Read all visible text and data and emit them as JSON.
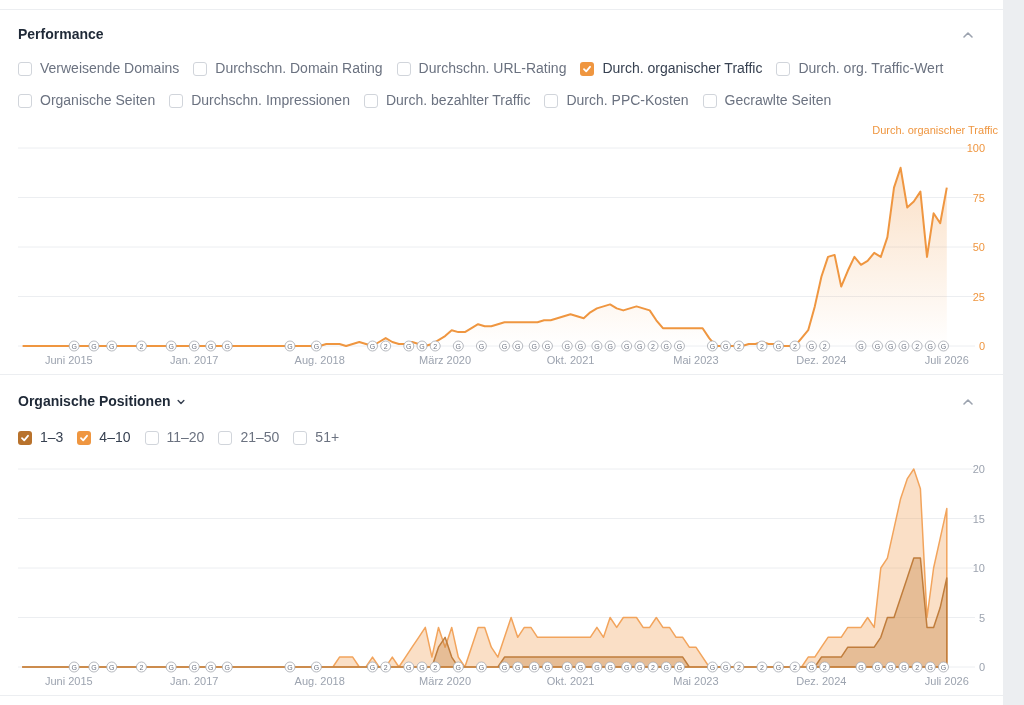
{
  "performance": {
    "title": "Performance",
    "expanded": true,
    "metrics": [
      {
        "label": "Verweisende Domains",
        "checked": false
      },
      {
        "label": "Durchschn. Domain Rating",
        "checked": false
      },
      {
        "label": "Durchschn. URL-Rating",
        "checked": false
      },
      {
        "label": "Durch. organischer Traffic",
        "checked": true
      },
      {
        "label": "Durch. org. Traffic-Wert",
        "checked": false
      },
      {
        "label": "Organische Seiten",
        "checked": false
      },
      {
        "label": "Durchschn. Impressionen",
        "checked": false
      },
      {
        "label": "Durch. bezahlter Traffic",
        "checked": false
      },
      {
        "label": "Durch. PPC-Kosten",
        "checked": false
      },
      {
        "label": "Gecrawlte Seiten",
        "checked": false
      }
    ],
    "chart_data": {
      "type": "line",
      "categories": [
        null,
        null,
        null,
        null,
        null,
        null,
        null,
        "Juni 2015",
        null,
        null,
        null,
        null,
        null,
        null,
        null,
        null,
        null,
        null,
        null,
        null,
        null,
        null,
        null,
        null,
        null,
        null,
        "Jan. 2017",
        null,
        null,
        null,
        null,
        null,
        null,
        null,
        null,
        null,
        null,
        null,
        null,
        null,
        null,
        null,
        null,
        null,
        null,
        "Aug. 2018",
        null,
        null,
        null,
        null,
        null,
        null,
        null,
        null,
        null,
        null,
        null,
        null,
        null,
        null,
        null,
        null,
        null,
        null,
        "März 2020",
        null,
        null,
        null,
        null,
        null,
        null,
        null,
        null,
        null,
        null,
        null,
        null,
        null,
        null,
        null,
        null,
        null,
        null,
        "Okt. 2021",
        null,
        null,
        null,
        null,
        null,
        null,
        null,
        null,
        null,
        null,
        null,
        null,
        null,
        null,
        null,
        null,
        null,
        null,
        "Mai 2023",
        null,
        null,
        null,
        null,
        null,
        null,
        null,
        null,
        null,
        null,
        null,
        null,
        null,
        null,
        null,
        null,
        null,
        null,
        "Dez. 2024",
        null,
        null,
        null,
        null,
        null,
        null,
        null,
        null,
        null,
        null,
        null,
        null,
        null,
        null,
        null,
        null,
        null,
        null,
        "Juli 2026",
        null
      ],
      "series": [
        {
          "name": "Durch. organischer Traffic",
          "color": "#ef9640",
          "values": [
            0,
            0,
            0,
            0,
            0,
            0,
            0,
            0,
            0,
            0,
            0,
            0,
            0,
            0,
            0,
            0,
            0,
            0,
            0,
            0,
            0,
            0,
            0,
            0,
            0,
            0,
            0,
            0,
            0,
            0,
            0,
            0,
            0,
            0,
            0,
            0,
            0,
            0,
            0,
            0,
            0,
            0,
            0,
            0,
            0,
            0,
            1,
            1,
            1,
            0,
            1,
            2,
            1,
            0,
            2,
            4,
            2,
            1,
            1,
            2,
            1,
            0,
            1,
            3,
            5,
            8,
            7,
            7,
            9,
            11,
            10,
            10,
            11,
            12,
            12,
            12,
            12,
            12,
            12,
            13,
            13,
            14,
            15,
            16,
            15,
            14,
            17,
            19,
            20,
            21,
            19,
            18,
            19,
            20,
            19,
            18,
            13,
            9,
            9,
            9,
            9,
            9,
            9,
            9,
            4,
            0,
            0,
            0,
            0,
            0,
            1,
            1,
            2,
            1,
            1,
            0,
            0,
            0,
            4,
            8,
            20,
            35,
            45,
            46,
            30,
            38,
            45,
            41,
            43,
            47,
            45,
            55,
            80,
            90,
            70,
            73,
            78,
            45,
            67,
            62,
            80,
            null
          ]
        }
      ],
      "ylim": [
        0,
        100
      ],
      "grid": true,
      "yticks": [
        0,
        25,
        50,
        75,
        100
      ]
    },
    "update_markers": [
      {
        "text": "G"
      },
      {
        "text": "G"
      },
      {
        "text": "G"
      },
      {
        "text": "2"
      },
      {
        "text": "G"
      },
      {
        "text": "G"
      },
      {
        "text": "G"
      },
      {
        "text": "G"
      },
      {
        "text": "G"
      },
      {
        "text": "G"
      },
      {
        "text": "G"
      },
      {
        "text": "2"
      },
      {
        "text": "G"
      },
      {
        "text": "G"
      },
      {
        "text": "2"
      },
      {
        "text": "G"
      },
      {
        "text": "G"
      },
      {
        "text": "G"
      },
      {
        "text": "G"
      },
      {
        "text": "G"
      },
      {
        "text": "G"
      },
      {
        "text": "G"
      },
      {
        "text": "G"
      },
      {
        "text": "G"
      },
      {
        "text": "G"
      },
      {
        "text": "G"
      },
      {
        "text": "G"
      },
      {
        "text": "2"
      },
      {
        "text": "G"
      },
      {
        "text": "G"
      },
      {
        "text": "G"
      },
      {
        "text": "G"
      },
      {
        "text": "2"
      },
      {
        "text": "2"
      },
      {
        "text": "G"
      },
      {
        "text": "2"
      },
      {
        "text": "G"
      },
      {
        "text": "2"
      },
      {
        "text": "G"
      },
      {
        "text": "G"
      },
      {
        "text": "G"
      },
      {
        "text": "G"
      },
      {
        "text": "2"
      },
      {
        "text": "G"
      },
      {
        "text": "G"
      }
    ]
  },
  "positions": {
    "title": "Organische Positionen",
    "dropdown": true,
    "expanded": true,
    "filters": [
      {
        "label": "1–3",
        "checked": true,
        "color": "#b8722c"
      },
      {
        "label": "4–10",
        "checked": true,
        "color": "#ef9640"
      },
      {
        "label": "11–20",
        "checked": false
      },
      {
        "label": "21–50",
        "checked": false
      },
      {
        "label": "51+",
        "checked": false
      }
    ],
    "chart_data": {
      "type": "area",
      "categories": [
        null,
        null,
        null,
        null,
        null,
        null,
        null,
        "Juni 2015",
        null,
        null,
        null,
        null,
        null,
        null,
        null,
        null,
        null,
        null,
        null,
        null,
        null,
        null,
        null,
        null,
        null,
        null,
        "Jan. 2017",
        null,
        null,
        null,
        null,
        null,
        null,
        null,
        null,
        null,
        null,
        null,
        null,
        null,
        null,
        null,
        null,
        null,
        null,
        "Aug. 2018",
        null,
        null,
        null,
        null,
        null,
        null,
        null,
        null,
        null,
        null,
        null,
        null,
        null,
        null,
        null,
        null,
        null,
        null,
        "März 2020",
        null,
        null,
        null,
        null,
        null,
        null,
        null,
        null,
        null,
        null,
        null,
        null,
        null,
        null,
        null,
        null,
        null,
        null,
        "Okt. 2021",
        null,
        null,
        null,
        null,
        null,
        null,
        null,
        null,
        null,
        null,
        null,
        null,
        null,
        null,
        null,
        null,
        null,
        null,
        "Mai 2023",
        null,
        null,
        null,
        null,
        null,
        null,
        null,
        null,
        null,
        null,
        null,
        null,
        null,
        null,
        null,
        null,
        null,
        null,
        "Dez. 2024",
        null,
        null,
        null,
        null,
        null,
        null,
        null,
        null,
        null,
        null,
        null,
        null,
        null,
        null,
        null,
        null,
        null,
        null,
        "Juli 2026",
        null
      ],
      "series": [
        {
          "color": "#f2a45c",
          "values": [
            0,
            0,
            0,
            0,
            0,
            0,
            0,
            0,
            0,
            0,
            0,
            0,
            0,
            0,
            0,
            0,
            0,
            0,
            0,
            0,
            0,
            0,
            0,
            0,
            0,
            0,
            0,
            0,
            0,
            0,
            0,
            0,
            0,
            0,
            0,
            0,
            0,
            0,
            0,
            0,
            0,
            0,
            0,
            0,
            0,
            0,
            0,
            0,
            1,
            1,
            1,
            0,
            0,
            1,
            0,
            0,
            1,
            0,
            1,
            2,
            3,
            4,
            1,
            4,
            2,
            4,
            1,
            0,
            2,
            4,
            4,
            2,
            1,
            3,
            5,
            3,
            4,
            4,
            3,
            3,
            3,
            3,
            3,
            3,
            3,
            3,
            3,
            4,
            3,
            5,
            4,
            5,
            5,
            5,
            4,
            4,
            5,
            4,
            4,
            3,
            3,
            2,
            2,
            1,
            0,
            0,
            0,
            0,
            0,
            0,
            0,
            0,
            0,
            0,
            0,
            0,
            0,
            0,
            0,
            1,
            1,
            2,
            3,
            3,
            3,
            4,
            4,
            4,
            5,
            4,
            10,
            11,
            14,
            17,
            19,
            20,
            18,
            5,
            10,
            13,
            16,
            null
          ]
        },
        {
          "color": "#c07d3c",
          "values": [
            0,
            0,
            0,
            0,
            0,
            0,
            0,
            0,
            0,
            0,
            0,
            0,
            0,
            0,
            0,
            0,
            0,
            0,
            0,
            0,
            0,
            0,
            0,
            0,
            0,
            0,
            0,
            0,
            0,
            0,
            0,
            0,
            0,
            0,
            0,
            0,
            0,
            0,
            0,
            0,
            0,
            0,
            0,
            0,
            0,
            0,
            0,
            0,
            0,
            0,
            0,
            0,
            0,
            0,
            0,
            0,
            0,
            0,
            0,
            0,
            0,
            0,
            0,
            2,
            3,
            1,
            0,
            0,
            0,
            0,
            0,
            0,
            0,
            1,
            1,
            1,
            1,
            1,
            1,
            1,
            1,
            1,
            1,
            1,
            1,
            1,
            1,
            1,
            1,
            1,
            1,
            1,
            1,
            1,
            1,
            1,
            1,
            1,
            1,
            1,
            1,
            0,
            0,
            0,
            0,
            0,
            0,
            0,
            0,
            0,
            0,
            0,
            0,
            0,
            0,
            0,
            0,
            0,
            0,
            0,
            0,
            1,
            1,
            1,
            1,
            2,
            2,
            2,
            2,
            2,
            3,
            5,
            5,
            7,
            9,
            11,
            11,
            4,
            4,
            6,
            9,
            null
          ]
        }
      ],
      "stacked": false,
      "ylim": [
        0,
        20
      ],
      "grid": true,
      "yticks": [
        0,
        5,
        10,
        15,
        20
      ]
    },
    "update_markers": [
      {
        "text": "G"
      },
      {
        "text": "G"
      },
      {
        "text": "G"
      },
      {
        "text": "2"
      },
      {
        "text": "G"
      },
      {
        "text": "G"
      },
      {
        "text": "G"
      },
      {
        "text": "G"
      },
      {
        "text": "G"
      },
      {
        "text": "G"
      },
      {
        "text": "G"
      },
      {
        "text": "2"
      },
      {
        "text": "G"
      },
      {
        "text": "G"
      },
      {
        "text": "2"
      },
      {
        "text": "G"
      },
      {
        "text": "G"
      },
      {
        "text": "G"
      },
      {
        "text": "G"
      },
      {
        "text": "G"
      },
      {
        "text": "G"
      },
      {
        "text": "G"
      },
      {
        "text": "G"
      },
      {
        "text": "G"
      },
      {
        "text": "G"
      },
      {
        "text": "G"
      },
      {
        "text": "G"
      },
      {
        "text": "2"
      },
      {
        "text": "G"
      },
      {
        "text": "G"
      },
      {
        "text": "G"
      },
      {
        "text": "G"
      },
      {
        "text": "2"
      },
      {
        "text": "2"
      },
      {
        "text": "G"
      },
      {
        "text": "2"
      },
      {
        "text": "G"
      },
      {
        "text": "2"
      },
      {
        "text": "G"
      },
      {
        "text": "G"
      },
      {
        "text": "G"
      },
      {
        "text": "G"
      },
      {
        "text": "2"
      },
      {
        "text": "G"
      },
      {
        "text": "G"
      }
    ]
  }
}
